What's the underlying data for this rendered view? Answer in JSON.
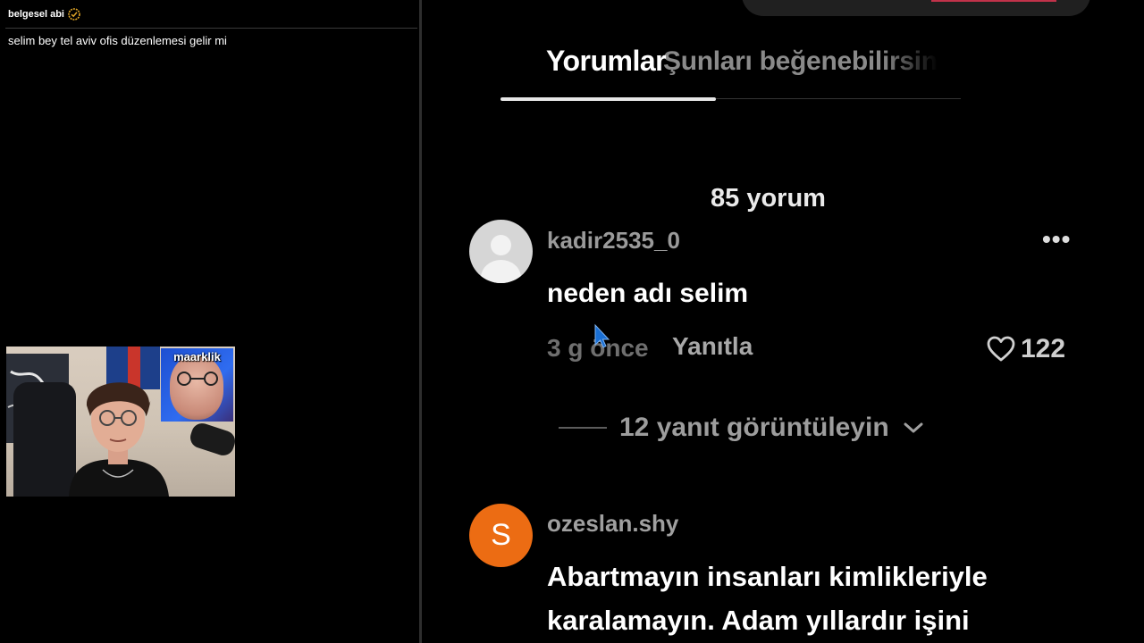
{
  "chat": {
    "username": "belgesel abi",
    "badge_icon": "verified-badge-icon",
    "message": "selim bey tel aviv ofis düzenlemesi gelir mi"
  },
  "webcam": {
    "inset_label": "maarklik"
  },
  "video": {
    "tabs": {
      "comments": "Yorumlar",
      "suggestions": "Şunları beğenebilirsin"
    },
    "comment_count": "85 yorum",
    "comments": [
      {
        "username": "kadir2535_0",
        "text": "neden adı selim",
        "time": "3 g önce",
        "reply_label": "Yanıtla",
        "likes": "122",
        "more_label": "•••"
      },
      {
        "username": "ozeslan.shy",
        "avatar_letter": "S",
        "text_line1": "Abartmayın insanları kimlikleriyle",
        "text_line2": "karalamayın. Adam yıllardır işini"
      }
    ],
    "view_replies": "12 yanıt görüntüleyin"
  },
  "colors": {
    "background": "#000000",
    "avatar_orange": "#ec6c13",
    "accent_red": "#c1324a"
  }
}
